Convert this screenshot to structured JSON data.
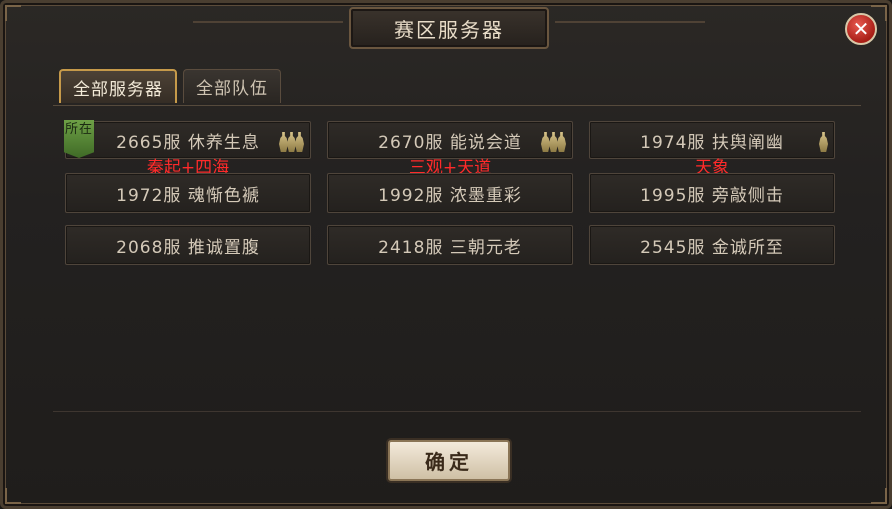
{
  "dialog": {
    "title": "赛区服务器",
    "close_icon": "close-icon",
    "confirm_label": "确定"
  },
  "tabs": [
    {
      "label": "全部服务器",
      "active": true
    },
    {
      "label": "全部队伍",
      "active": false
    }
  ],
  "current_tag": "所在",
  "servers": [
    {
      "name": "2665服 休养生息",
      "soldiers": 3,
      "annotation": "秦起+四海"
    },
    {
      "name": "2670服 能说会道",
      "soldiers": 3,
      "annotation": "三观+天道"
    },
    {
      "name": "1974服 扶舆阐幽",
      "soldiers": 1,
      "annotation": "天象"
    },
    {
      "name": "1972服 魂惭色褫"
    },
    {
      "name": "1992服 浓墨重彩"
    },
    {
      "name": "1995服 旁敲侧击"
    },
    {
      "name": "2068服 推诚置腹"
    },
    {
      "name": "2418服 三朝元老"
    },
    {
      "name": "2545服 金诚所至"
    }
  ],
  "colors": {
    "annotation": "#ff2a2a",
    "tab_active_border": "#c69a4a",
    "close_button": "#c0281e"
  }
}
